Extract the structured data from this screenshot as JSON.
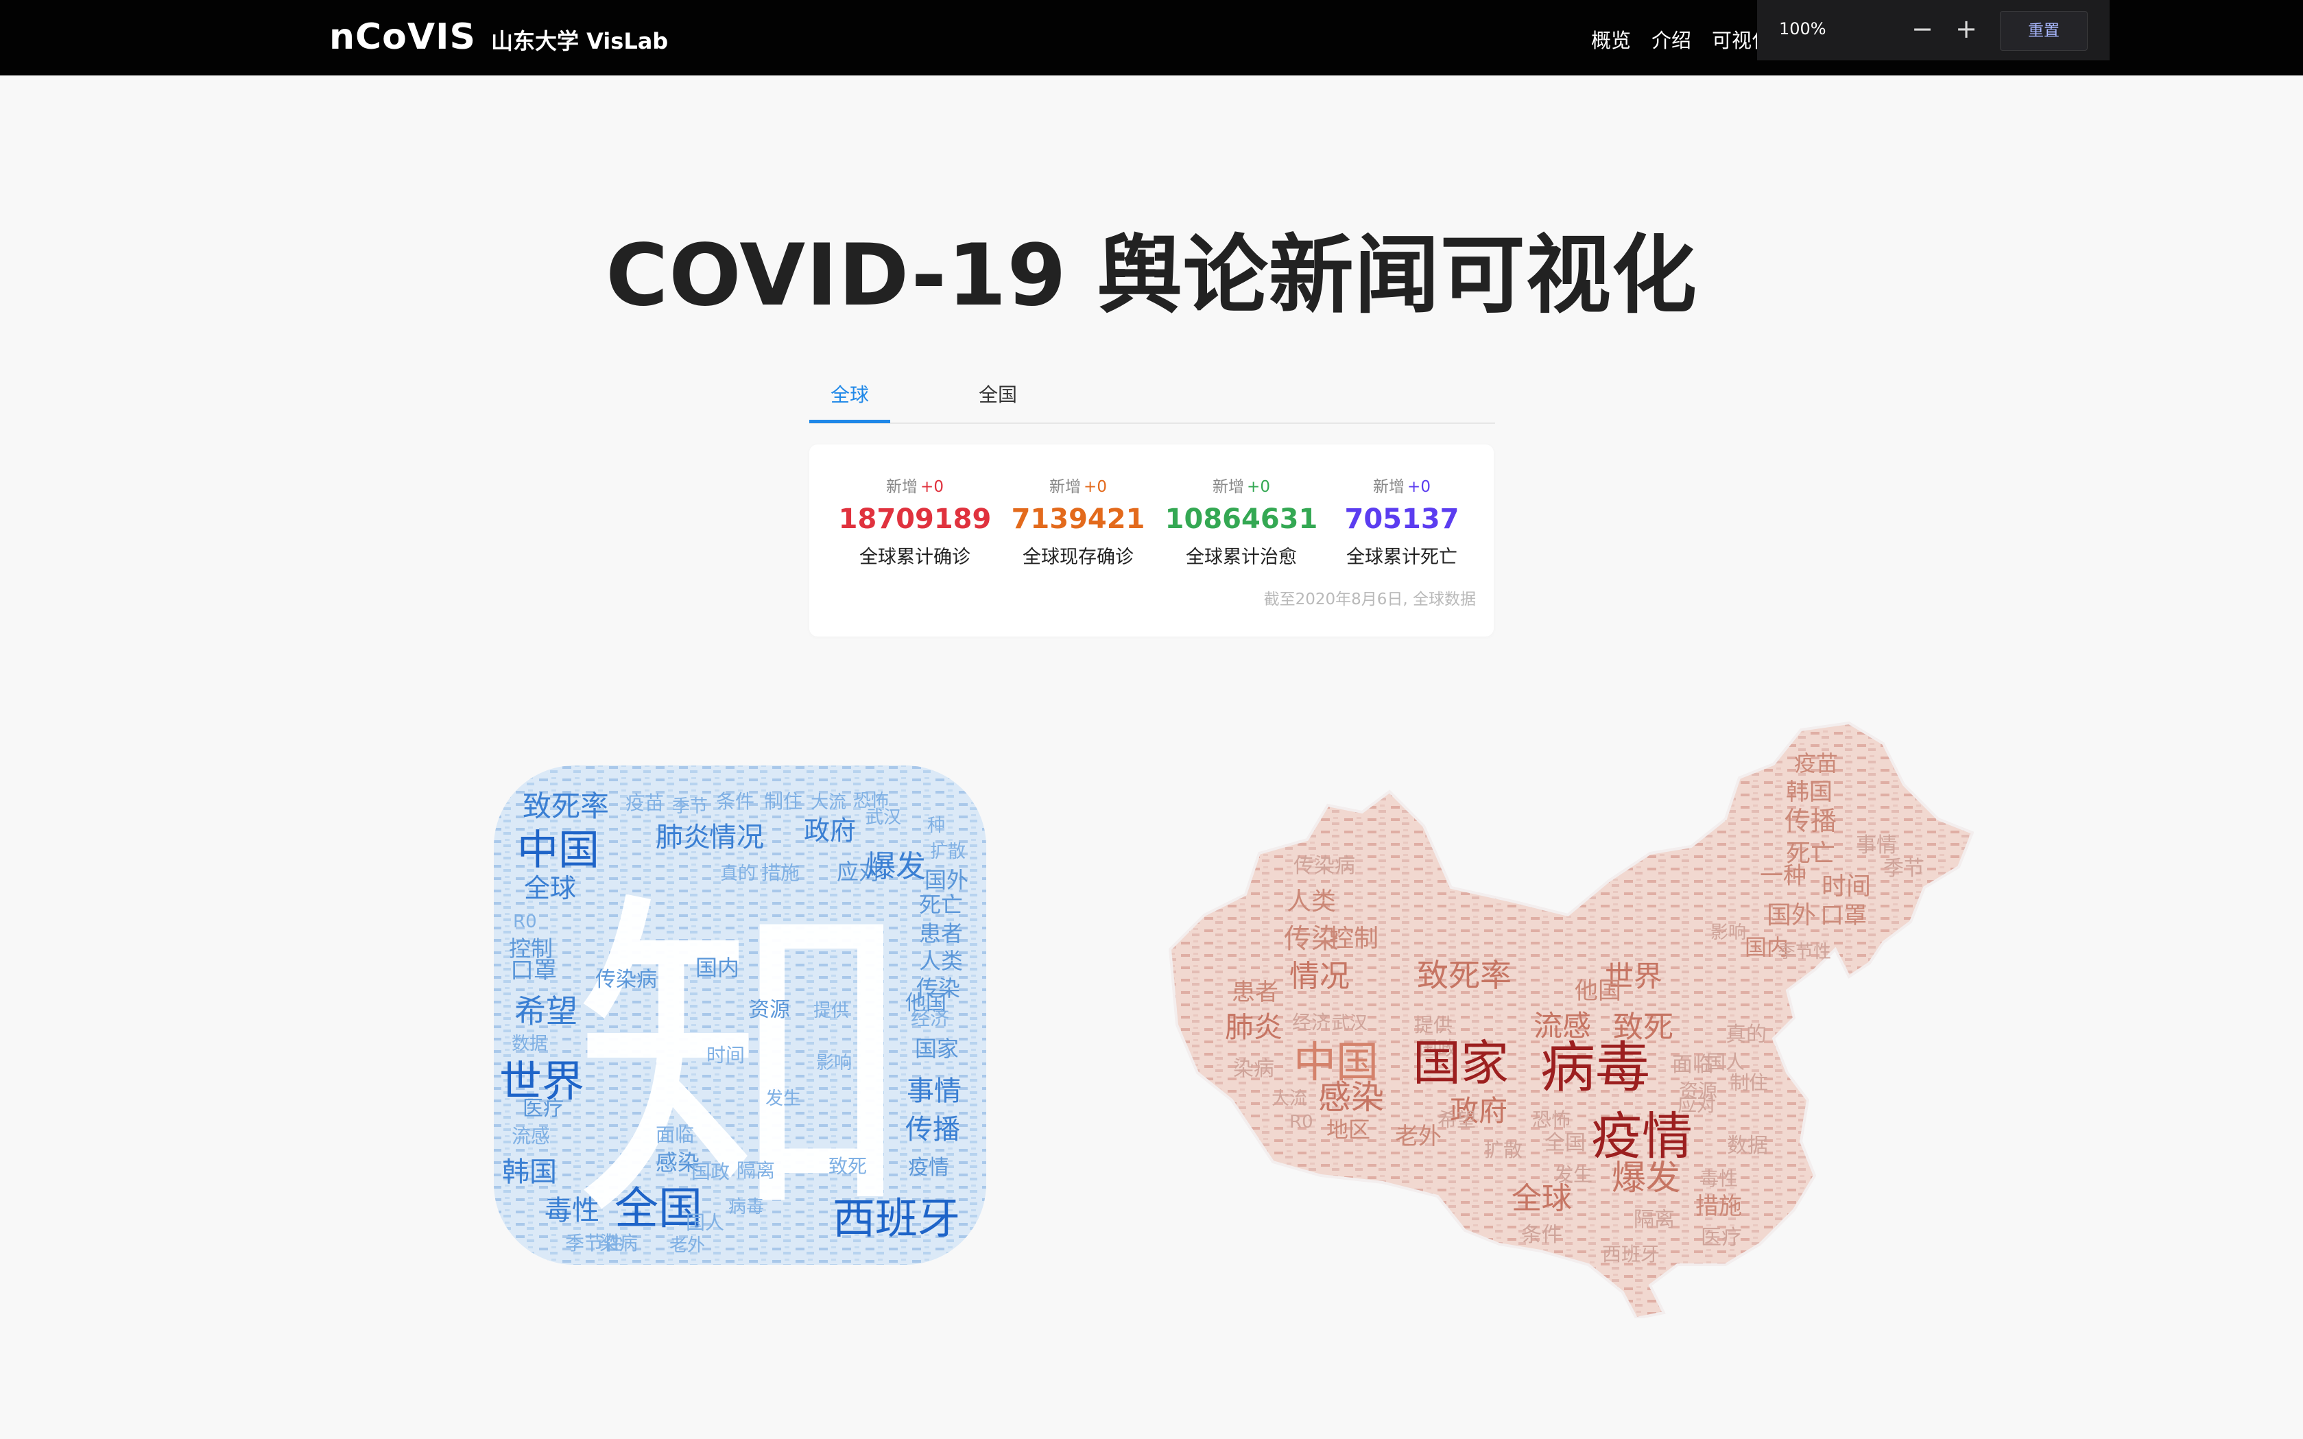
{
  "header": {
    "logo": "nCoVIS",
    "org": "山东大学 VisLab",
    "nav": [
      "概览",
      "介绍",
      "可视化"
    ],
    "zoom": {
      "level": "100%",
      "minus": "−",
      "plus": "+",
      "reset": "重置"
    }
  },
  "title": "COVID-19 舆论新闻可视化",
  "tabs": [
    "全球",
    "全国"
  ],
  "stats": [
    {
      "new_label": "新增",
      "delta": "+0",
      "value": "18709189",
      "label": "全球累计确诊",
      "color": "#e0323e"
    },
    {
      "new_label": "新增",
      "delta": "+0",
      "value": "7139421",
      "label": "全球现存确诊",
      "color": "#e36a1c"
    },
    {
      "new_label": "新增",
      "delta": "+0",
      "value": "10864631",
      "label": "全球累计治愈",
      "color": "#34a853"
    },
    {
      "new_label": "新增",
      "delta": "+0",
      "value": "705137",
      "label": "全球累计死亡",
      "color": "#5b3df0"
    }
  ],
  "stats_footnote": "截至2020年8月6日, 全球数据",
  "zhihu_cloud": {
    "big_char": "知",
    "words": [
      "致死率",
      "疫苗",
      "季节",
      "条件",
      "制住",
      "大流",
      "恐怖",
      "中国",
      "肺炎",
      "情况",
      "政府",
      "武汉",
      "种",
      "扩散",
      "全球",
      "真的",
      "措施",
      "应对",
      "爆发",
      "国外",
      "R0",
      "死亡",
      "控制",
      "患者",
      "人类",
      "传染病",
      "口罩",
      "传染",
      "国内",
      "他国",
      "资源",
      "希望",
      "提供",
      "经济",
      "数据",
      "时间",
      "国家",
      "影响",
      "世界",
      "发生",
      "事情",
      "医疗",
      "流感",
      "传播",
      "面临",
      "感染",
      "隔离",
      "韩国",
      "国政",
      "致死",
      "疫情",
      "毒性",
      "全国",
      "病毒",
      "国人",
      "西班牙",
      "季节性",
      "染病",
      "老外"
    ]
  },
  "china_cloud": {
    "words": [
      "疫苗",
      "韩国",
      "传播",
      "死亡",
      "事情",
      "季节",
      "时间",
      "一种",
      "国外",
      "口罩",
      "传染病",
      "人类",
      "传染",
      "控制",
      "影响",
      "国内",
      "季节性",
      "情况",
      "致死率",
      "世界",
      "他国",
      "患者",
      "肺炎",
      "经济",
      "武汉",
      "提供",
      "流感",
      "致死",
      "真的",
      "国政",
      "国人",
      "面临",
      "染病",
      "中国",
      "国家",
      "病毒",
      "制住",
      "大流",
      "资源",
      "感染",
      "政府",
      "应对",
      "R0",
      "地区",
      "老外",
      "希望",
      "恐怖",
      "疫情",
      "数据",
      "全国",
      "扩散",
      "发生",
      "爆发",
      "毒性",
      "全球",
      "隔离",
      "措施",
      "条件",
      "医疗",
      "西班牙"
    ]
  }
}
